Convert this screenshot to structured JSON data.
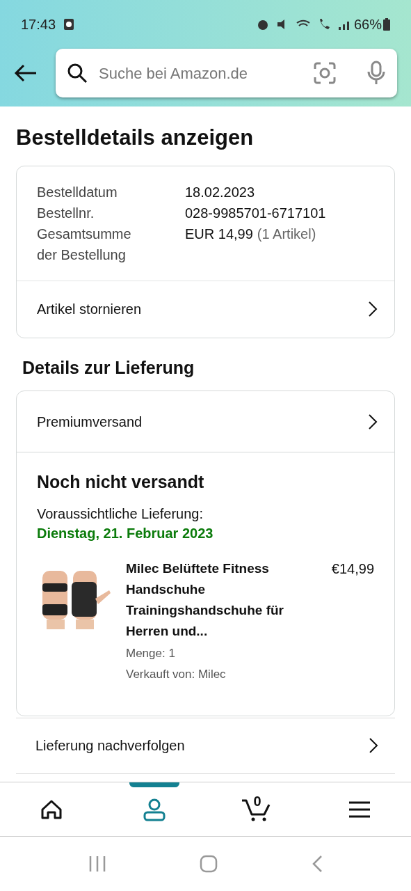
{
  "status_bar": {
    "time": "17:43",
    "battery": "66%"
  },
  "search": {
    "placeholder": "Suche bei Amazon.de"
  },
  "title": "Bestelldetails anzeigen",
  "order_summary": {
    "fields": [
      {
        "label": "Bestelldatum",
        "value": "18.02.2023"
      },
      {
        "label": "Bestellnr.",
        "value": "028-9985701-6717101"
      },
      {
        "label": "Gesamtsumme der Bestellung",
        "value": "EUR 14,99",
        "note": "(1 Artikel)"
      }
    ],
    "action": "Artikel stornieren"
  },
  "delivery_heading": "Details zur Lieferung",
  "delivery": {
    "shipping": "Premiumversand",
    "status": "Noch nicht versandt",
    "estimate_label": "Voraussichtliche Lieferung:",
    "estimate_date": "Dienstag, 21. Februar 2023",
    "item": {
      "title": "Milec Belüftete Fitness Handschuhe Trainingshandschuhe für Herren und...",
      "price": "€14,99",
      "quantity": "Menge: 1",
      "seller": "Verkauft von: Milec"
    }
  },
  "actions": [
    "Lieferung nachverfolgen"
  ],
  "bottom_nav": [
    {
      "kind": "home",
      "selected": false
    },
    {
      "kind": "account",
      "selected": true
    },
    {
      "kind": "cart",
      "selected": false,
      "count": "0"
    },
    {
      "kind": "menu",
      "selected": false
    }
  ]
}
